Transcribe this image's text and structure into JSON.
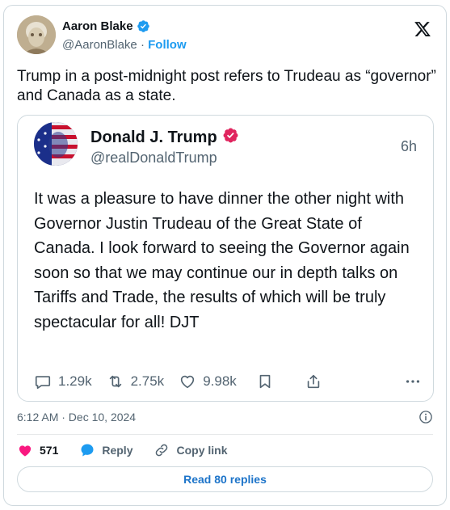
{
  "author": {
    "name": "Aaron Blake",
    "handle": "@AaronBlake",
    "separator": "·",
    "follow_label": "Follow",
    "verified_color": "#1d9bf0"
  },
  "tweet": {
    "text": "Trump in a post-midnight post refers to Trudeau as “governor” and Canada as a state."
  },
  "embedded_post": {
    "name": "Donald J. Trump",
    "handle": "@realDonaldTrump",
    "time_ago": "6h",
    "verified_color": "#e0245e",
    "text": "It was a pleasure to have dinner the other night with Governor Justin Trudeau of the Great State of Canada. I look forward to seeing the Governor again soon so that we may continue our in depth talks on Tariffs and Trade, the results of which will be truly spectacular for all! DJT",
    "actions": {
      "replies": "1.29k",
      "reposts": "2.75k",
      "likes": "9.98k"
    }
  },
  "timestamp": "6:12 AM · Dec 10, 2024",
  "footer": {
    "like_count": "571",
    "reply_label": "Reply",
    "copy_link_label": "Copy link",
    "read_replies_label": "Read 80 replies",
    "like_color": "#f91880",
    "accent_color": "#1d9bf0"
  },
  "icons": [
    "x-logo-icon",
    "verified-badge-icon",
    "comment-icon",
    "repost-icon",
    "heart-icon",
    "bookmark-icon",
    "share-icon",
    "more-icon",
    "info-icon",
    "reply-bubble-icon",
    "link-icon"
  ]
}
